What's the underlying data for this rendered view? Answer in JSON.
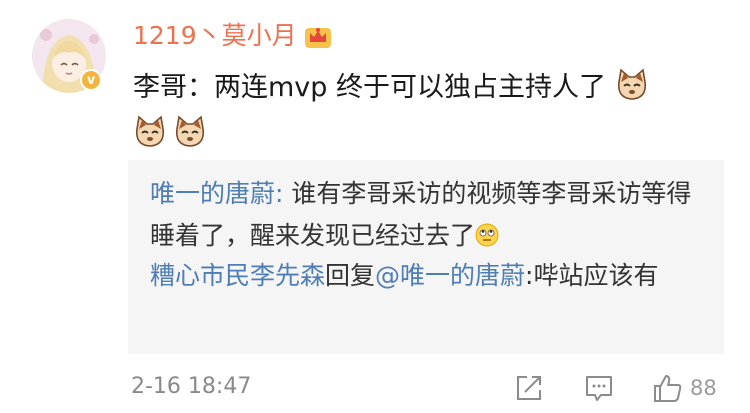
{
  "post": {
    "username": "1219丶莫小月",
    "comment": "李哥：两连mvp 终于可以独占主持人了",
    "time": "2-16 18:47",
    "like_count": "88"
  },
  "replies": [
    {
      "author": "唯一的唐蔚",
      "separator": ": ",
      "text": "谁有李哥采访的视频等李哥采访等得睡着了，醒来发现已经过去了"
    },
    {
      "author": "糟心市民李先森",
      "middle": "回复",
      "mention": "@唯一的唐蔚",
      "text": ":哔站应该有"
    }
  ],
  "colors": {
    "username": "#eb7350",
    "link": "#4f7db5",
    "reply_bg": "#f5f5f5",
    "badge": "#f4b53f"
  },
  "icons": [
    "avatar",
    "verified-badge-icon",
    "crown-icon",
    "cat-emoji-icon",
    "eye-roll-emoji-icon",
    "share-icon",
    "comment-icon",
    "like-icon"
  ]
}
